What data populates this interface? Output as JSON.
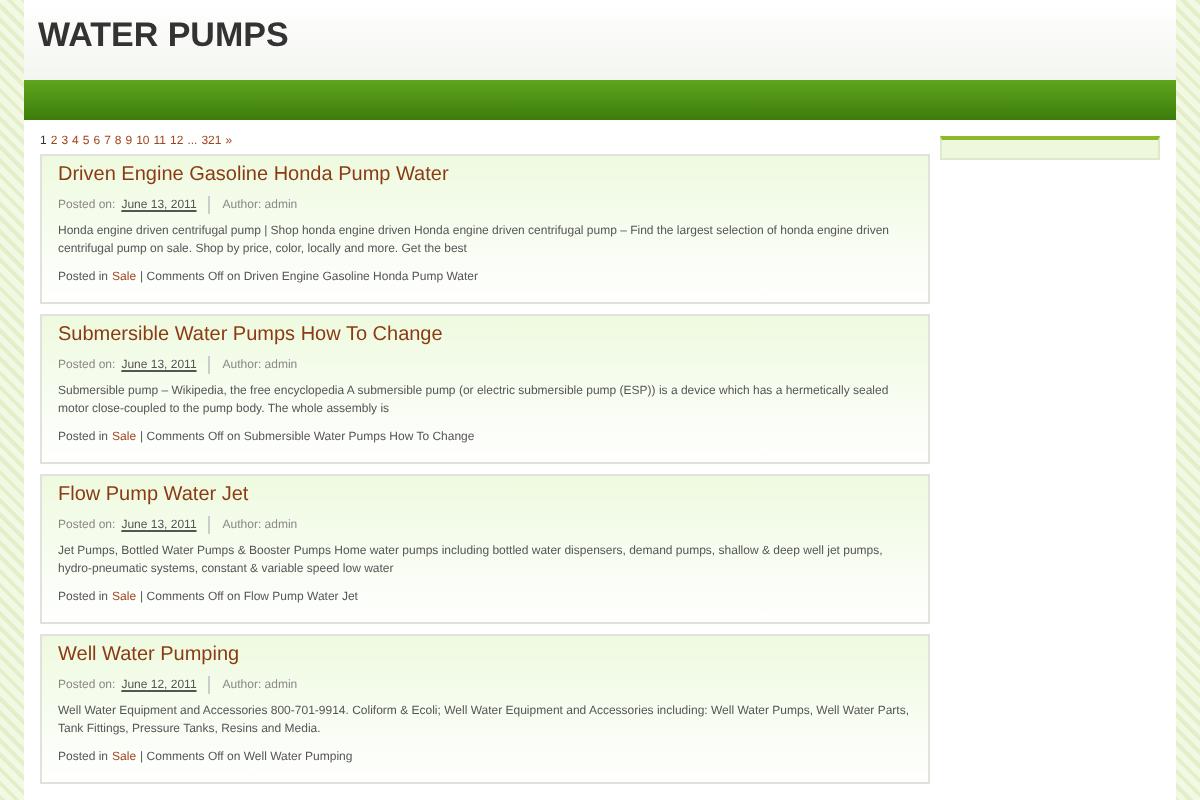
{
  "site_title": "WATER PUMPS",
  "pagination": [
    {
      "label": "1",
      "selected": true
    },
    {
      "label": "2",
      "selected": false
    },
    {
      "label": "3",
      "selected": false
    },
    {
      "label": "4",
      "selected": false
    },
    {
      "label": "5",
      "selected": false
    },
    {
      "label": "6",
      "selected": false
    },
    {
      "label": "7",
      "selected": false
    },
    {
      "label": "8",
      "selected": false
    },
    {
      "label": "9",
      "selected": false
    },
    {
      "label": "10",
      "selected": false
    },
    {
      "label": "11",
      "selected": false
    },
    {
      "label": "12",
      "selected": false
    },
    {
      "label": "...",
      "selected": false
    },
    {
      "label": "321",
      "selected": false
    },
    {
      "label": "»",
      "selected": false
    }
  ],
  "posts": [
    {
      "title": "Driven Engine Gasoline Honda Pump Water",
      "posted_label": "Posted on:",
      "date": "June 13, 2011",
      "author": "Author: admin",
      "excerpt": "Honda engine driven centrifugal pump | Shop honda engine driven Honda engine driven centrifugal pump – Find the largest selection of honda engine driven centrifugal pump on sale. Shop by price, color, locally and more. Get the best",
      "category_label": "Posted in",
      "category": "Sale",
      "comments": "| Comments Off on Driven Engine Gasoline Honda Pump Water"
    },
    {
      "title": "Submersible Water Pumps How To Change",
      "posted_label": "Posted on:",
      "date": "June 13, 2011",
      "author": "Author: admin",
      "excerpt": "Submersible pump – Wikipedia, the free encyclopedia A submersible pump (or electric submersible pump (ESP)) is a device which has a hermetically sealed motor close-coupled to the pump body. The whole assembly is",
      "category_label": "Posted in",
      "category": "Sale",
      "comments": "| Comments Off on Submersible Water Pumps How To Change"
    },
    {
      "title": "Flow Pump Water Jet",
      "posted_label": "Posted on:",
      "date": "June 13, 2011",
      "author": "Author: admin",
      "excerpt": "Jet Pumps, Bottled Water Pumps & Booster Pumps Home water pumps including bottled water dispensers, demand pumps, shallow & deep well jet pumps, hydro-pneumatic systems, constant & variable speed low water",
      "category_label": "Posted in",
      "category": "Sale",
      "comments": "| Comments Off on Flow Pump Water Jet"
    },
    {
      "title": "Well Water Pumping",
      "posted_label": "Posted on:",
      "date": "June 12, 2011",
      "author": "Author: admin",
      "excerpt": "Well Water Equipment and Accessories 800-701-9914. Coliform & Ecoli; Well Water Equipment and Accessories including: Well Water Pumps, Well Water Parts, Tank Fittings, Pressure Tanks, Resins and Media.",
      "category_label": "Posted in",
      "category": "Sale",
      "comments": "| Comments Off on Well Water Pumping"
    }
  ]
}
